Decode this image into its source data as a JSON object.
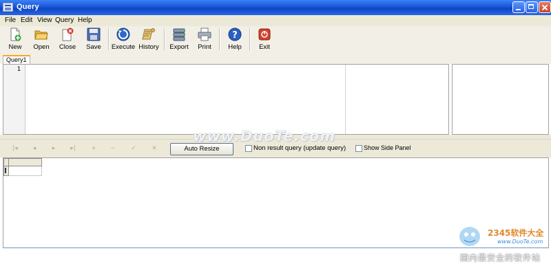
{
  "window": {
    "title": "Query",
    "app_icon_text": "MS\nFILE",
    "controls": [
      "minimize",
      "maximize",
      "close"
    ]
  },
  "menu": {
    "items": [
      {
        "label": "File"
      },
      {
        "label": "Edit"
      },
      {
        "label": "View"
      },
      {
        "label": "Query"
      },
      {
        "label": "Help"
      }
    ]
  },
  "toolbar": {
    "buttons": [
      {
        "label": "New",
        "icon": "new-document-icon"
      },
      {
        "label": "Open",
        "icon": "open-folder-icon"
      },
      {
        "label": "Close",
        "icon": "close-document-icon"
      },
      {
        "label": "Save",
        "icon": "save-floppy-icon"
      },
      {
        "label": "Execute",
        "icon": "execute-icon"
      },
      {
        "label": "History",
        "icon": "history-scroll-icon"
      },
      {
        "label": "Export",
        "icon": "export-database-icon"
      },
      {
        "label": "Print",
        "icon": "printer-icon"
      },
      {
        "label": "Help",
        "icon": "help-icon"
      },
      {
        "label": "Exit",
        "icon": "exit-icon"
      }
    ]
  },
  "tabs": [
    {
      "label": "Query1",
      "active": true
    }
  ],
  "editor": {
    "line_numbers": [
      "1"
    ],
    "content": ""
  },
  "navigator": {
    "buttons": [
      {
        "icon": "first-record-icon"
      },
      {
        "icon": "prior-record-icon"
      },
      {
        "icon": "next-record-icon"
      },
      {
        "icon": "last-record-icon"
      },
      {
        "icon": "insert-record-icon"
      },
      {
        "icon": "delete-record-icon"
      },
      {
        "icon": "post-edit-icon"
      },
      {
        "icon": "cancel-edit-icon"
      }
    ],
    "auto_resize_label": "Auto Resize",
    "non_result_query_label": "Non result query (update query)",
    "non_result_query_checked": false,
    "show_side_panel_label": "Show Side Panel",
    "show_side_panel_checked": false
  },
  "watermarks": {
    "main": "www.DuoTe.com",
    "logo_text": "2345软件大全",
    "logo_sub": "www.DuoTe.com",
    "footer": "国内最安全的软件站"
  },
  "colors": {
    "titlebar": "#0a45c6",
    "tab_accent": "#f5a623",
    "chrome": "#ece9d8"
  }
}
